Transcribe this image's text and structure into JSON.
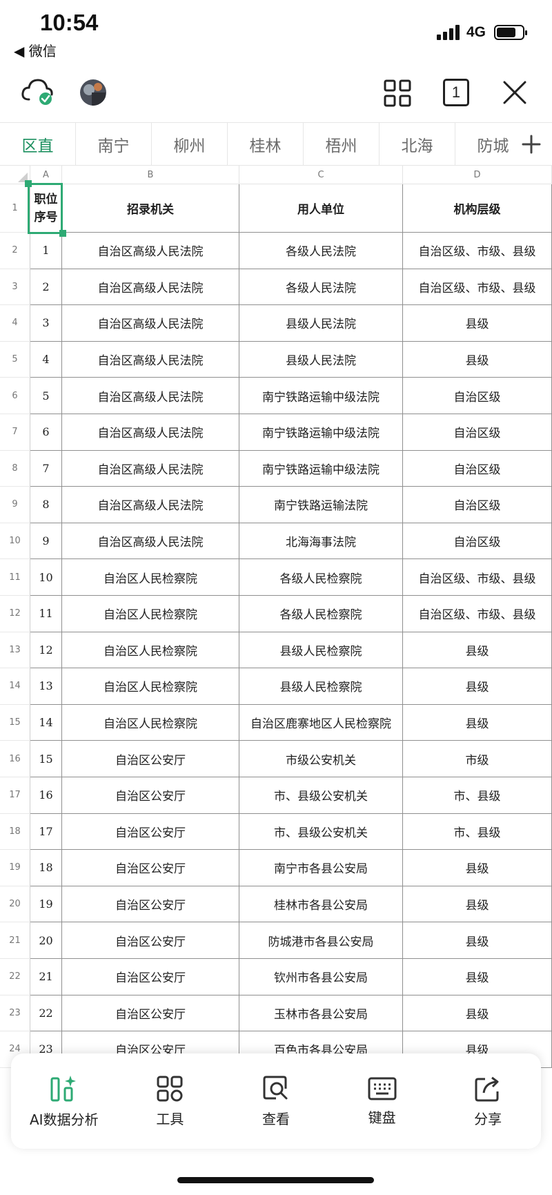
{
  "status_bar": {
    "time": "10:54",
    "back_app": "◀ 微信",
    "network": "4G",
    "battery_level": 0.75
  },
  "toolbar": {
    "cloud_icon": "cloud-synced-icon",
    "avatar_icon": "avatar",
    "grid_icon": "grid-view-icon",
    "window_count": "1",
    "close_icon": "close-icon"
  },
  "sheet_tabs": [
    "区直",
    "南宁",
    "柳州",
    "桂林",
    "梧州",
    "北海",
    "防城"
  ],
  "active_tab": 0,
  "column_headers": [
    "A",
    "B",
    "C",
    "D"
  ],
  "table": {
    "header_row": [
      "职位\n序号",
      "招录机关",
      "用人单位",
      "机构层级"
    ],
    "rows": [
      [
        "1",
        "自治区高级人民法院",
        "各级人民法院",
        "自治区级、市级、县级"
      ],
      [
        "2",
        "自治区高级人民法院",
        "各级人民法院",
        "自治区级、市级、县级"
      ],
      [
        "3",
        "自治区高级人民法院",
        "县级人民法院",
        "县级"
      ],
      [
        "4",
        "自治区高级人民法院",
        "县级人民法院",
        "县级"
      ],
      [
        "5",
        "自治区高级人民法院",
        "南宁铁路运输中级法院",
        "自治区级"
      ],
      [
        "6",
        "自治区高级人民法院",
        "南宁铁路运输中级法院",
        "自治区级"
      ],
      [
        "7",
        "自治区高级人民法院",
        "南宁铁路运输中级法院",
        "自治区级"
      ],
      [
        "8",
        "自治区高级人民法院",
        "南宁铁路运输法院",
        "自治区级"
      ],
      [
        "9",
        "自治区高级人民法院",
        "北海海事法院",
        "自治区级"
      ],
      [
        "10",
        "自治区人民检察院",
        "各级人民检察院",
        "自治区级、市级、县级"
      ],
      [
        "11",
        "自治区人民检察院",
        "各级人民检察院",
        "自治区级、市级、县级"
      ],
      [
        "12",
        "自治区人民检察院",
        "县级人民检察院",
        "县级"
      ],
      [
        "13",
        "自治区人民检察院",
        "县级人民检察院",
        "县级"
      ],
      [
        "14",
        "自治区人民检察院",
        "自治区鹿寨地区人民检察院",
        "县级"
      ],
      [
        "15",
        "自治区公安厅",
        "市级公安机关",
        "市级"
      ],
      [
        "16",
        "自治区公安厅",
        "市、县级公安机关",
        "市、县级"
      ],
      [
        "17",
        "自治区公安厅",
        "市、县级公安机关",
        "市、县级"
      ],
      [
        "18",
        "自治区公安厅",
        "南宁市各县公安局",
        "县级"
      ],
      [
        "19",
        "自治区公安厅",
        "桂林市各县公安局",
        "县级"
      ],
      [
        "20",
        "自治区公安厅",
        "防城港市各县公安局",
        "县级"
      ],
      [
        "21",
        "自治区公安厅",
        "钦州市各县公安局",
        "县级"
      ],
      [
        "22",
        "自治区公安厅",
        "玉林市各县公安局",
        "县级"
      ],
      [
        "23",
        "自治区公安厅",
        "百色市各县公安局",
        "县级"
      ]
    ]
  },
  "bottom_panel": [
    {
      "label": "AI数据分析",
      "icon": "ai-data-analysis-icon"
    },
    {
      "label": "工具",
      "icon": "tools-icon"
    },
    {
      "label": "查看",
      "icon": "view-icon"
    },
    {
      "label": "键盘",
      "icon": "keyboard-icon"
    },
    {
      "label": "分享",
      "icon": "share-icon"
    }
  ],
  "colors": {
    "accent": "#2eaa74",
    "active_tab": "#1a8f5e"
  }
}
